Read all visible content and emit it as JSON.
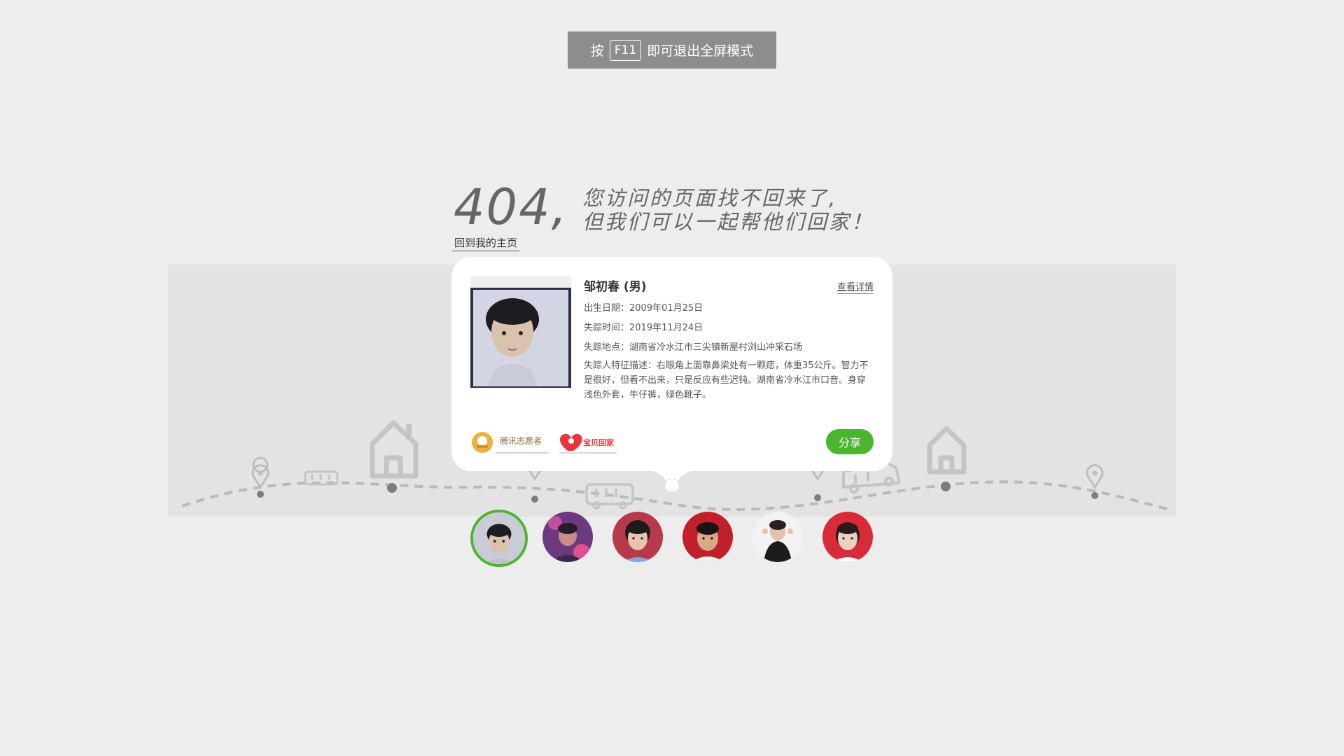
{
  "fullscreen_hint": {
    "prefix": "按",
    "key": "F11",
    "suffix": "即可退出全屏模式"
  },
  "title": {
    "code": "404,",
    "line1": "您访问的页面找不回来了,",
    "line2": "但我们可以一起帮他们回家！"
  },
  "home_link": "回到我的主页",
  "card": {
    "name": "邹初春 (男)",
    "detail_link": "查看详情",
    "birth_label": "出生日期：",
    "birth_value": "2009年01月25日",
    "missing_time_label": "失踪时间：",
    "missing_time_value": "2019年11月24日",
    "missing_place_label": "失踪地点：",
    "missing_place_value": "湖南省冷水江市三尖镇新屋村浏山冲采石场",
    "features_label": "失踪人特征描述：",
    "features_value": "右眼角上面靠鼻梁处有一颗痣，体重35公斤。智力不是很好，但看不出来，只是反应有些迟钝。湖南省冷水江市口音。身穿浅色外套，牛仔裤，绿色靴子。",
    "share_label": "分享",
    "logos": [
      "腾讯志愿者",
      "宝贝回家"
    ]
  },
  "avatars": [
    {
      "name": "avatar-1",
      "bg": "#c9cbd6",
      "active": true
    },
    {
      "name": "avatar-2",
      "bg": "#7a3f8e",
      "active": false
    },
    {
      "name": "avatar-3",
      "bg": "#b83a4a",
      "active": false
    },
    {
      "name": "avatar-4",
      "bg": "#c0202a",
      "active": false
    },
    {
      "name": "avatar-5",
      "bg": "#f2f2f2",
      "active": false
    },
    {
      "name": "avatar-6",
      "bg": "#d92a3a",
      "active": false
    }
  ],
  "colors": {
    "accent_green": "#4cb52f",
    "hint_bg": "#8d8d8d",
    "page_bg": "#ededed",
    "band_bg": "#e3e3e3"
  }
}
